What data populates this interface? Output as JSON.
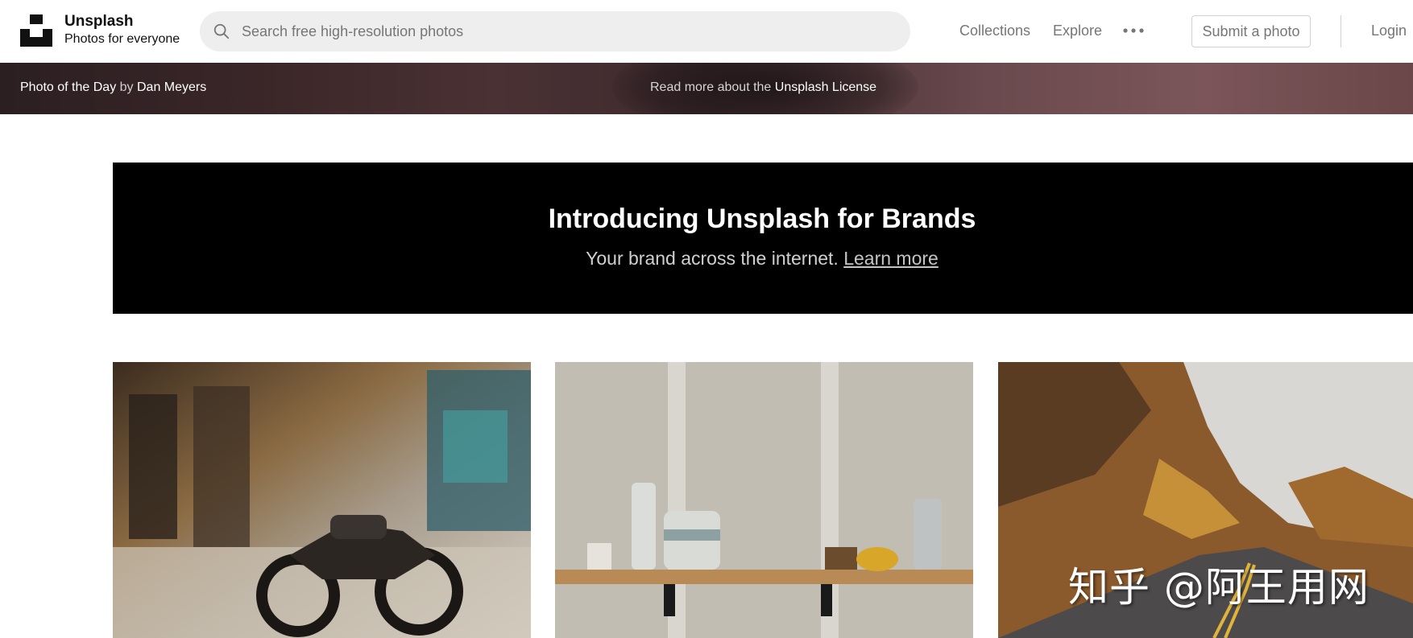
{
  "header": {
    "brand_name": "Unsplash",
    "brand_tagline": "Photos for everyone",
    "search_placeholder": "Search free high-resolution photos",
    "nav": [
      {
        "label": "Collections"
      },
      {
        "label": "Explore"
      }
    ],
    "more_icon": "more-horizontal-icon",
    "submit_label": "Submit a photo",
    "login_label": "Login"
  },
  "potd": {
    "prefix": "Photo of the Day",
    "by": "by",
    "author": "Dan Meyers",
    "license_prefix": "Read more about the",
    "license_link": "Unsplash License"
  },
  "banner": {
    "title": "Introducing Unsplash for Brands",
    "subtitle": "Your brand across the internet.",
    "link": "Learn more"
  },
  "watermark": "知乎 @阿王用网",
  "colors": {
    "banner_bg": "#000000",
    "search_bg": "#eeeeee",
    "nav_text": "#767676"
  }
}
